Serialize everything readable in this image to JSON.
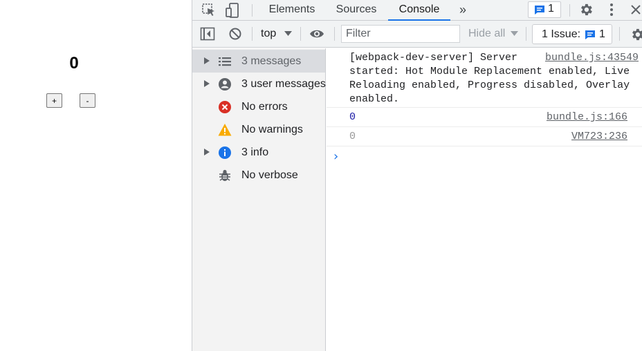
{
  "page": {
    "counter": "0",
    "plus_label": "+",
    "minus_label": "-"
  },
  "devtools": {
    "tabs": [
      {
        "label": "Elements",
        "active": false
      },
      {
        "label": "Sources",
        "active": false
      },
      {
        "label": "Console",
        "active": true
      }
    ],
    "more_tabs": "»",
    "message_badge_count": "1",
    "toolbar": {
      "context": "top",
      "filter_placeholder": "Filter",
      "levels": "Hide all",
      "issues_label": "1 Issue:",
      "issues_count": "1"
    },
    "sidebar": [
      {
        "label": "3 messages",
        "icon": "list-icon",
        "expandable": true,
        "selected": true
      },
      {
        "label": "3 user messages",
        "icon": "user-icon",
        "expandable": true,
        "selected": false
      },
      {
        "label": "No errors",
        "icon": "error-icon",
        "expandable": false,
        "selected": false
      },
      {
        "label": "No warnings",
        "icon": "warning-icon",
        "expandable": false,
        "selected": false
      },
      {
        "label": "3 info",
        "icon": "info-icon",
        "expandable": true,
        "selected": false
      },
      {
        "label": "No verbose",
        "icon": "bug-icon",
        "expandable": false,
        "selected": false
      }
    ],
    "messages": [
      {
        "text": "[webpack-dev-server] Server\nstarted: Hot Module Replacement enabled, Live\nReloading enabled, Progress disabled, Overlay\nenabled.",
        "source": "bundle.js:43549"
      },
      {
        "text": "0",
        "source": "bundle.js:166"
      },
      {
        "text": "0",
        "source": "VM723:236"
      }
    ],
    "prompt": "›"
  },
  "colors": {
    "accent": "#1a73e8",
    "error": "#d93025",
    "warning": "#f9ab00",
    "info": "#1a73e8",
    "number_dark": "#1a1aa6",
    "number_faded": "#999999"
  }
}
